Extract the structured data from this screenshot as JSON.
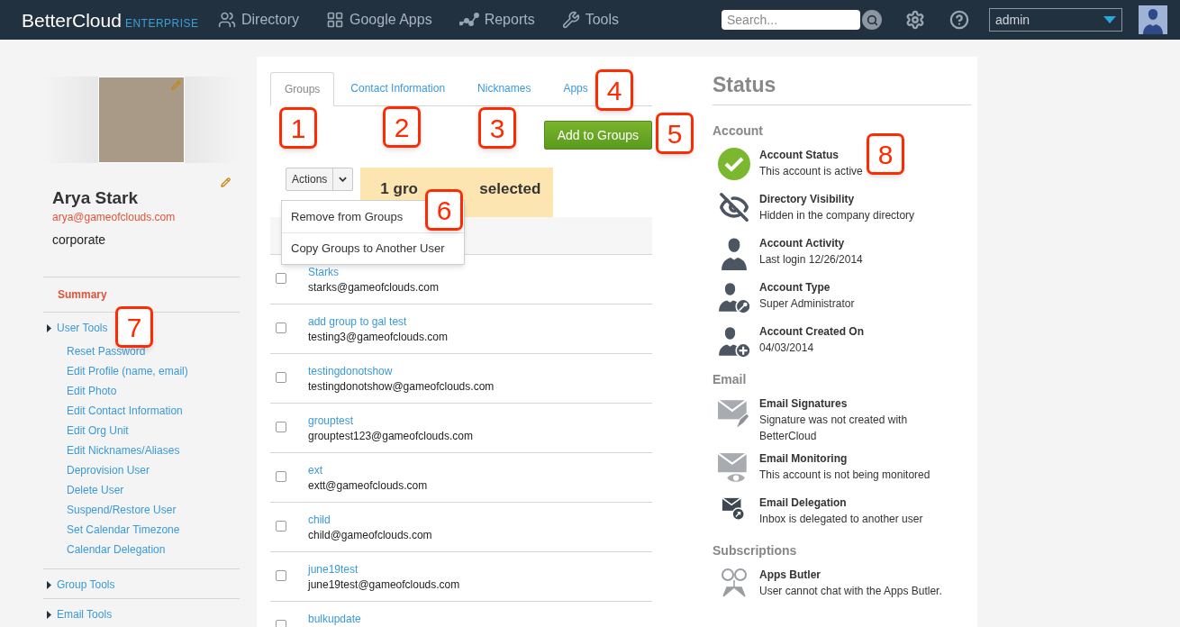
{
  "nav": {
    "logo": "BetterCloud",
    "edition": "ENTERPRISE",
    "items": [
      {
        "kind": "directory",
        "label": "Directory"
      },
      {
        "kind": "apps",
        "label": "Google Apps"
      },
      {
        "kind": "reports",
        "label": "Reports"
      },
      {
        "kind": "tools",
        "label": "Tools"
      }
    ]
  },
  "search": {
    "placeholder": "Search..."
  },
  "account_select": {
    "value": "admin"
  },
  "profile": {
    "name": "Arya Stark",
    "email": "arya@gameofclouds.com",
    "org": "corporate"
  },
  "sidebar": {
    "summary": "Summary",
    "sections": [
      {
        "label": "User Tools",
        "children": [
          "Reset Password",
          "Edit Profile (name, email)",
          "Edit Photo",
          "Edit Contact Information",
          "Edit Org Unit",
          "Edit Nicknames/Aliases",
          "Deprovision User",
          "Delete User",
          "Suspend/Restore User",
          "Set Calendar Timezone",
          "Calendar Delegation"
        ]
      },
      {
        "label": "Group Tools"
      },
      {
        "label": "Email Tools"
      }
    ]
  },
  "tabs": [
    {
      "label": "Groups",
      "selected": true
    },
    {
      "label": "Contact Information",
      "selected": false
    },
    {
      "label": "Nicknames",
      "selected": false
    },
    {
      "label": "Apps",
      "selected": false
    }
  ],
  "add_button": "Add to Groups",
  "actions": {
    "label": "Actions",
    "menu": [
      "Remove from Groups",
      "Copy Groups to Another User"
    ]
  },
  "banner": {
    "text_start": "1 gro",
    "text_end": "selected"
  },
  "groups": [
    {
      "name": "Starks",
      "email": "starks@gameofclouds.com",
      "checked": false
    },
    {
      "name": "add group to gal test",
      "email": "testing3@gameofclouds.com",
      "checked": false
    },
    {
      "name": "testingdonotshow",
      "email": "testingdonotshow@gameofclouds.com",
      "checked": false
    },
    {
      "name": "grouptest",
      "email": "grouptest123@gameofclouds.com",
      "checked": false
    },
    {
      "name": "ext",
      "email": "extt@gameofclouds.com",
      "checked": false
    },
    {
      "name": "child",
      "email": "child@gameofclouds.com",
      "checked": false
    },
    {
      "name": "june19test",
      "email": "june19test@gameofclouds.com",
      "checked": false
    },
    {
      "name": "bulkupdate",
      "checked": false
    }
  ],
  "status": {
    "title": "Status",
    "sections": [
      {
        "heading": "Account",
        "items": [
          {
            "kind": "active",
            "title": "Account Status",
            "detail": "This account is active"
          },
          {
            "kind": "hidden",
            "title": "Directory Visibility",
            "detail": "Hidden in the company directory"
          },
          {
            "kind": "person",
            "title": "Account Activity",
            "detail": "Last login 12/26/2014"
          },
          {
            "kind": "admin",
            "title": "Account Type",
            "detail": "Super Administrator"
          },
          {
            "kind": "created",
            "title": "Account Created On",
            "detail": "04/03/2014"
          }
        ]
      },
      {
        "heading": "Email",
        "items": [
          {
            "kind": "signature",
            "title": "Email Signatures",
            "detail": "Signature was not created with BetterCloud"
          },
          {
            "kind": "monitoring",
            "title": "Email Monitoring",
            "detail": "This account is not being monitored"
          },
          {
            "kind": "delegation",
            "title": "Email Delegation",
            "detail": "Inbox is delegated to another user"
          }
        ]
      },
      {
        "heading": "Subscriptions",
        "items": [
          {
            "kind": "butler",
            "title": "Apps Butler",
            "detail": "User cannot chat with the Apps Butler."
          }
        ]
      }
    ]
  },
  "callouts": [
    "1",
    "2",
    "3",
    "4",
    "5",
    "6",
    "7",
    "8"
  ]
}
